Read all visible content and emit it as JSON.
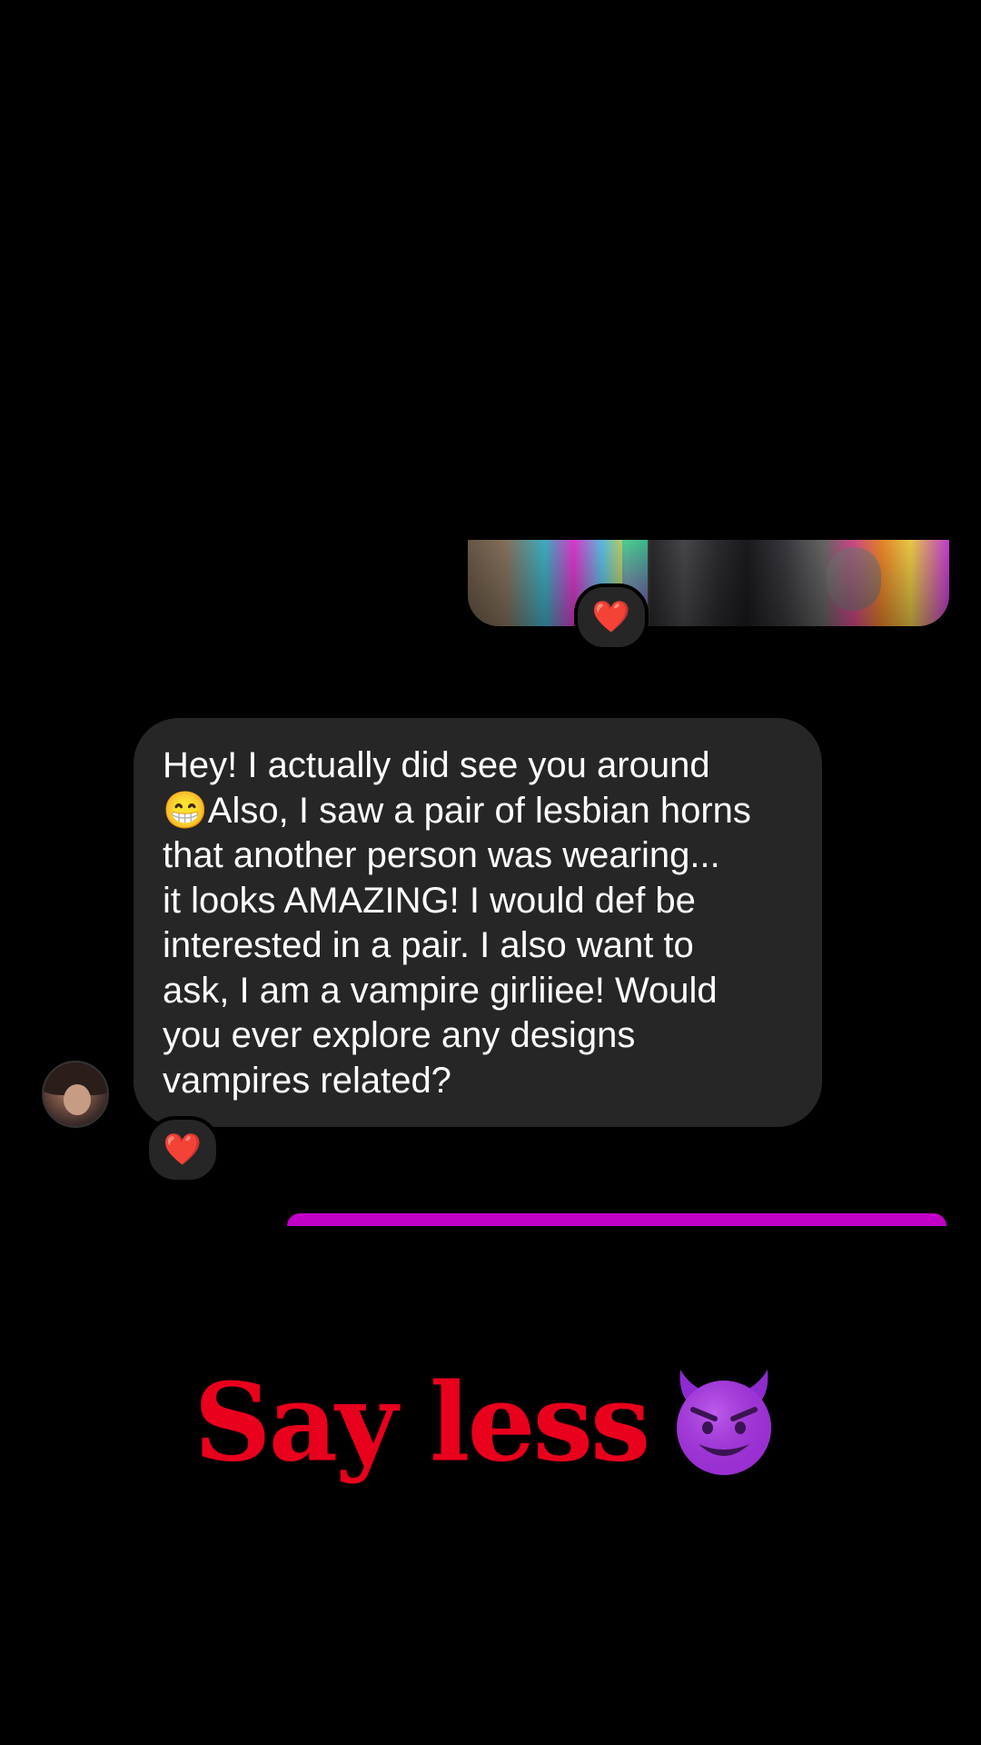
{
  "thread": {
    "sent_photo": {
      "reaction": "❤️"
    },
    "received_message": {
      "text": "Hey! I actually did see you around\n😁Also, I saw a pair of lesbian horns\nthat another person was wearing...\nit looks AMAZING! I would def be\ninterested in a pair. I also want to\nask, I am a vampire girliiee! Would\nyou ever explore any designs\nvampires related?",
      "reaction": "❤️"
    }
  },
  "caption": {
    "text": "Say less",
    "emoji_icon": "smiling-devil-icon"
  },
  "colors": {
    "background": "#000000",
    "received_bubble": "#262626",
    "sent_bubble": "#c000c4",
    "caption_text": "#e8001c",
    "reaction_heart": "#ff2a3d"
  }
}
